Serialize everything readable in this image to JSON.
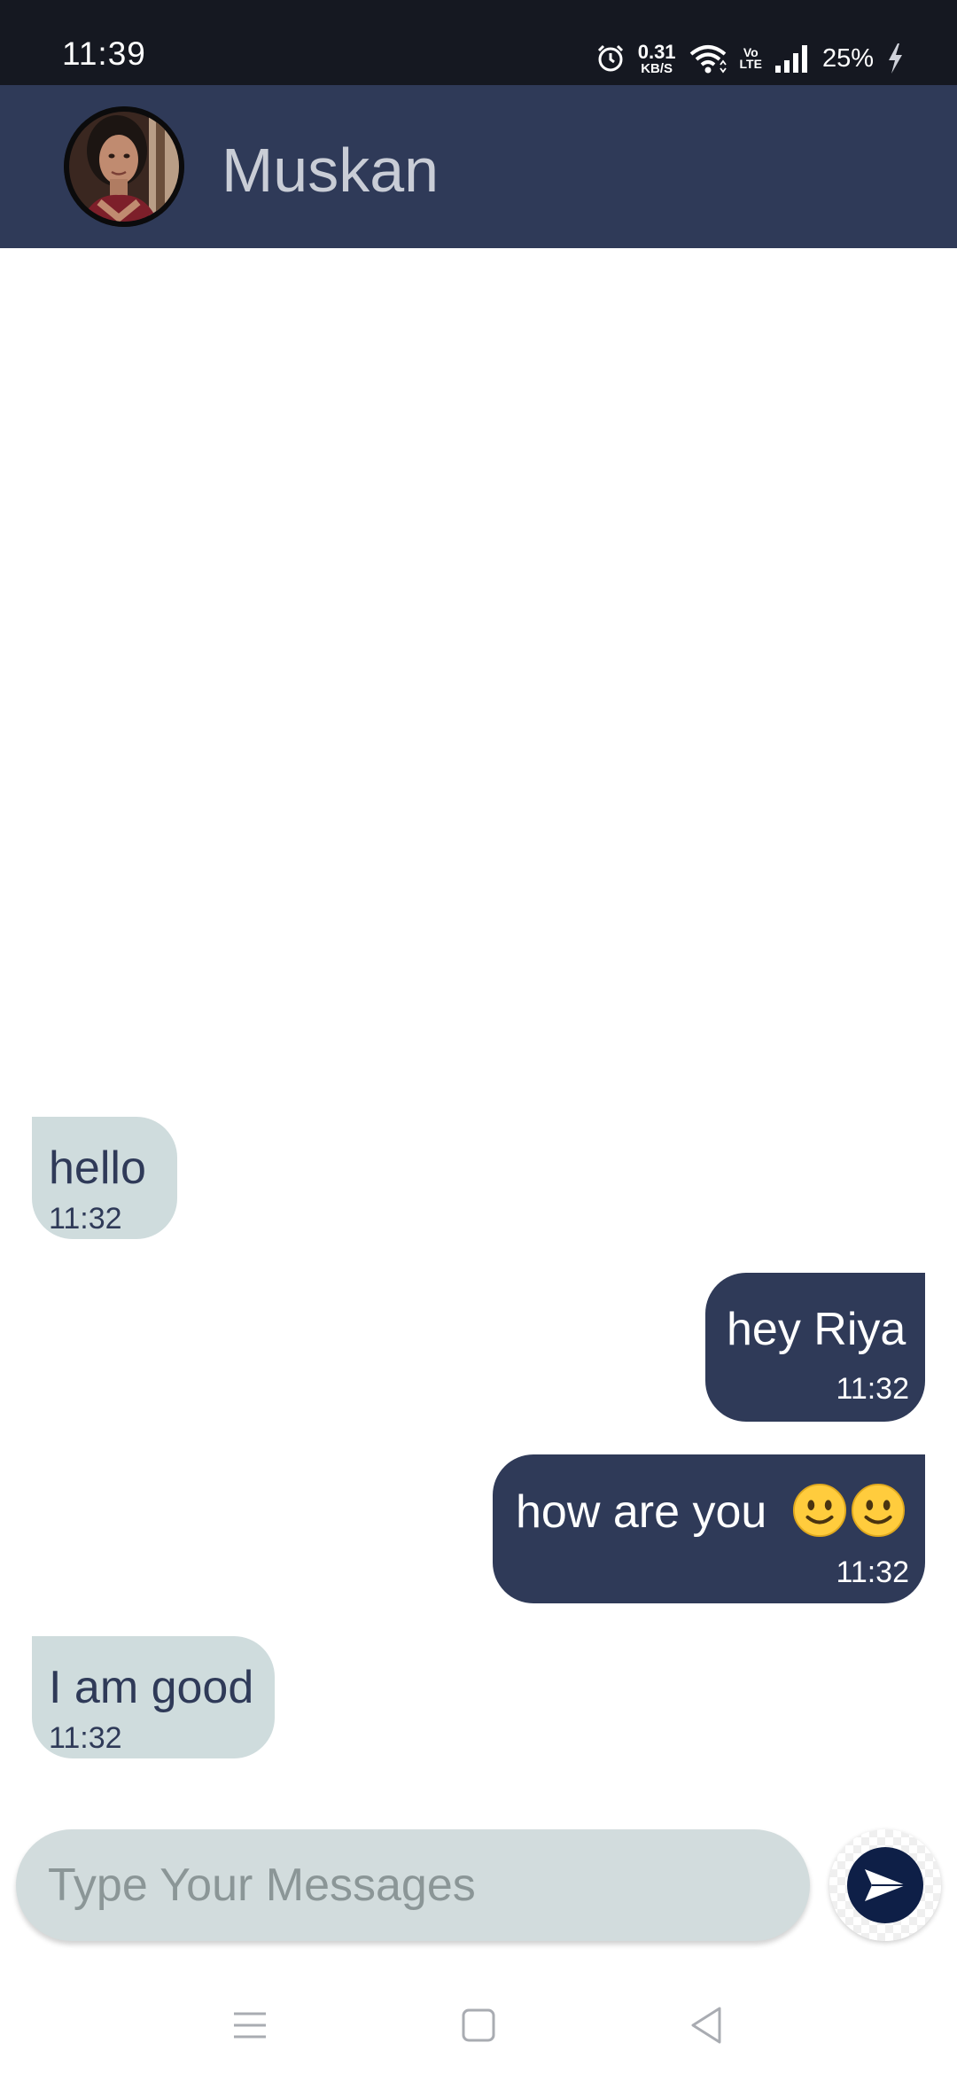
{
  "status_bar": {
    "time": "11:39",
    "net_speed_value": "0.31",
    "net_speed_unit": "KB/S",
    "volte_top": "Vo",
    "volte_bottom": "LTE",
    "battery": "25%"
  },
  "header": {
    "contact_name": "Muskan"
  },
  "messages": [
    {
      "direction": "incoming",
      "text": "hello",
      "time": "11:32"
    },
    {
      "direction": "outgoing",
      "text": "hey Riya",
      "time": "11:32"
    },
    {
      "direction": "outgoing",
      "text": "how are you",
      "emoji": [
        "slightly-smiling-face",
        "slightly-smiling-face"
      ],
      "time": "11:32"
    },
    {
      "direction": "incoming",
      "text": "I am good",
      "time": "11:32"
    }
  ],
  "composer": {
    "placeholder": "Type Your Messages",
    "value": ""
  },
  "colors": {
    "header": "#2f3a58",
    "incoming_bubble": "#cfdcdd",
    "outgoing_bubble": "#2f3a58",
    "status_bar": "#151821",
    "send_button": "#0e1f47"
  }
}
